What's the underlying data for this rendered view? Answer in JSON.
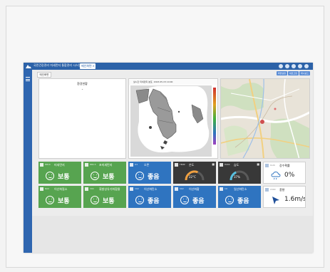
{
  "app": {
    "title": "국민건강관리 미세먼지 통합관리 시스템",
    "tab_label": "메인화면",
    "tab_close": "×"
  },
  "toolbar": {
    "sub_tab": "메인화면",
    "buttons": [
      "화면설정",
      "새로고침",
      "대시보드"
    ]
  },
  "panels": {
    "info": {
      "title": "환경현황",
      "value": "-"
    },
    "map": {
      "title": "실시간 미세먼지 분포",
      "timestamp": "2023.05.15 10:00"
    }
  },
  "cards_row1": [
    {
      "label": "미세먼지",
      "sub": "PM10",
      "status": "보통",
      "color": "#57a450"
    },
    {
      "label": "초미세먼지",
      "sub": "PM2.5",
      "status": "보통",
      "color": "#57a450"
    },
    {
      "label": "오존",
      "sub": "O3",
      "status": "좋음",
      "color": "#2f74c0"
    },
    {
      "label": "온도",
      "sub": "TEMP",
      "value": "22°C",
      "level": 0.62,
      "color": "#383838"
    },
    {
      "label": "습도",
      "sub": "HUMI",
      "value": "37%",
      "level": 0.37,
      "color": "#383838"
    },
    {
      "label": "강수확률",
      "sub": "RAIN",
      "value": "0%",
      "icon": "rain-cloud-icon",
      "color": "#ffffff"
    }
  ],
  "cards_row2": [
    {
      "label": "이산화질소",
      "sub": "NO2",
      "status": "보통",
      "color": "#57a450"
    },
    {
      "label": "휘발성유기화합물",
      "sub": "VOC",
      "status": "보통",
      "color": "#57a450"
    },
    {
      "label": "이산화탄소",
      "sub": "CO2",
      "status": "좋음",
      "color": "#2f74c0"
    },
    {
      "label": "이산화황",
      "sub": "SO2",
      "status": "좋음",
      "color": "#2f74c0"
    },
    {
      "label": "일산화탄소",
      "sub": "CO",
      "status": "좋음",
      "color": "#2f74c0"
    },
    {
      "label": "풍향",
      "sub": "WIND",
      "value": "1.6m/s",
      "icon": "wind-arrow-icon",
      "color": "#ffffff"
    }
  ]
}
